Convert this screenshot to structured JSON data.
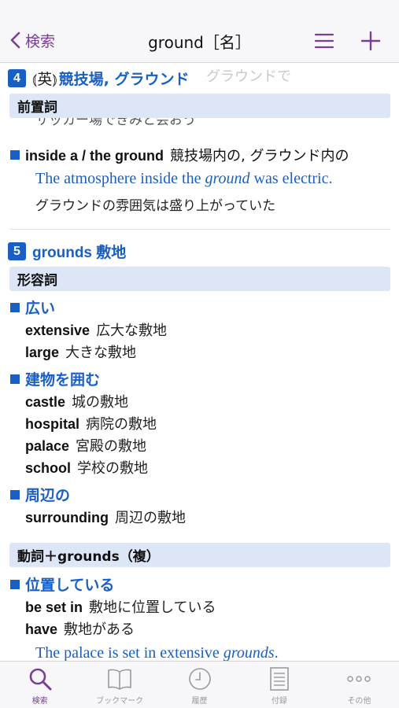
{
  "nav": {
    "back_label": "検索",
    "title": "ground［名］"
  },
  "ghost": {
    "line1": "グラウンドで",
    "line2": "サッカー場できみと会おう"
  },
  "sense4": {
    "number": "4",
    "paren": "⦅英⦆",
    "label": "競技場, グラウンド",
    "section": "前置詞",
    "phrase_en": "inside a / the ground",
    "phrase_ja": "競技場内の, グラウンド内の",
    "example_pre": "The atmosphere inside the ",
    "example_italic": "ground",
    "example_post": " was electric.",
    "translation": "グラウンドの雰囲気は盛り上がっていた"
  },
  "sense5": {
    "number": "5",
    "label": "grounds 敷地",
    "section_adj": "形容詞",
    "groups": [
      {
        "heading": "広い",
        "entries": [
          {
            "en": "extensive",
            "ja": "広大な敷地"
          },
          {
            "en": "large",
            "ja": "大きな敷地"
          }
        ]
      },
      {
        "heading": "建物を囲む",
        "entries": [
          {
            "en": "castle",
            "ja": "城の敷地"
          },
          {
            "en": "hospital",
            "ja": "病院の敷地"
          },
          {
            "en": "palace",
            "ja": "宮殿の敷地"
          },
          {
            "en": "school",
            "ja": "学校の敷地"
          }
        ]
      },
      {
        "heading": "周辺の",
        "entries": [
          {
            "en": "surrounding",
            "ja": "周辺の敷地"
          }
        ]
      }
    ],
    "section_verb": "動詞＋grounds（複）",
    "verb_heading": "位置している",
    "verb_entries": [
      {
        "en": "be set in",
        "ja": "敷地に位置している"
      },
      {
        "en": "have",
        "ja": "敷地がある"
      }
    ],
    "example_pre": "The palace is set in extensive ",
    "example_italic": "grounds",
    "example_post": "."
  },
  "tabs": [
    {
      "label": "検索",
      "icon": "search-icon"
    },
    {
      "label": "ブックマーク",
      "icon": "book-icon"
    },
    {
      "label": "履歴",
      "icon": "clock-icon"
    },
    {
      "label": "付録",
      "icon": "document-icon"
    },
    {
      "label": "その他",
      "icon": "more-icon"
    }
  ],
  "colors": {
    "accent": "#7a3d96",
    "link_blue": "#1a5fc3",
    "section_bg": "#dce6f7"
  }
}
